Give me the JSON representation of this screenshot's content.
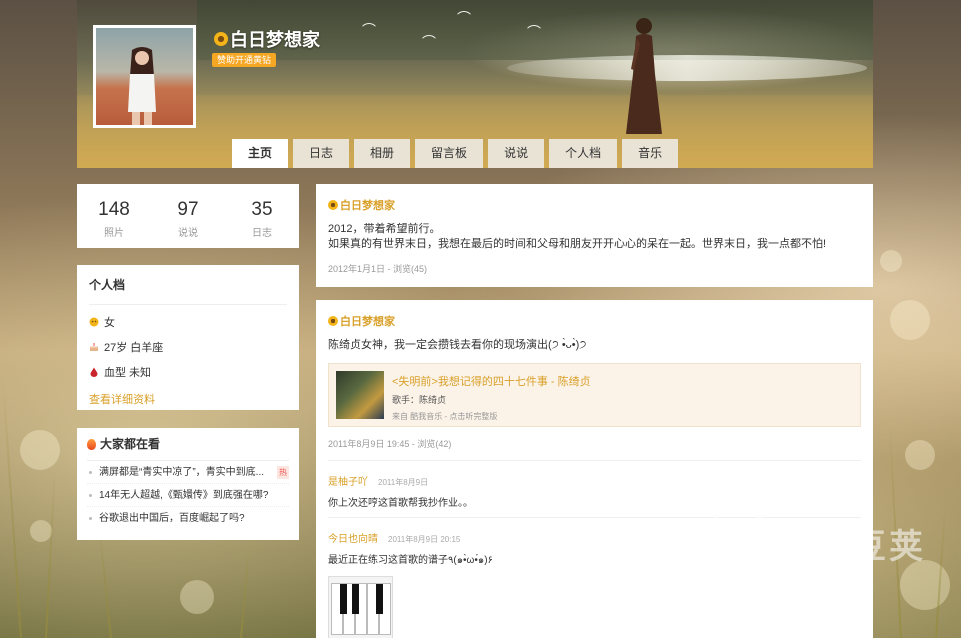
{
  "owner": {
    "name": "白日梦想家",
    "vip_label": "赞助开通黄钻",
    "accent_color": "#d9a02a"
  },
  "nav": {
    "tabs": [
      {
        "label": "主页",
        "active": true
      },
      {
        "label": "日志",
        "active": false
      },
      {
        "label": "相册",
        "active": false
      },
      {
        "label": "留言板",
        "active": false
      },
      {
        "label": "说说",
        "active": false
      },
      {
        "label": "个人档",
        "active": false
      },
      {
        "label": "音乐",
        "active": false
      }
    ]
  },
  "stats": [
    {
      "value": "148",
      "label": "照片"
    },
    {
      "value": "97",
      "label": "说说"
    },
    {
      "value": "35",
      "label": "日志"
    }
  ],
  "profile": {
    "title": "个人档",
    "gender": "女",
    "age_sign": "27岁 白羊座",
    "blood": "血型 未知",
    "more_link": "查看详细资料"
  },
  "trending": {
    "title": "大家都在看",
    "items": [
      {
        "text": "满屏都是“青实中凉了”，青实中到底...",
        "badge": "热"
      },
      {
        "text": "14年无人超越,《甄嬛传》到底强在哪?",
        "badge": ""
      },
      {
        "text": "谷歌退出中国后，百度崛起了吗?",
        "badge": ""
      }
    ]
  },
  "posts": [
    {
      "author": "白日梦想家",
      "line1": "2012，带着希望前行。",
      "line2": "如果真的有世界末日，我想在最后的时间和父母和朋友开开心心的呆在一起。世界末日，我一点都不怕!",
      "meta": "2012年1月1日 - ",
      "views": "浏览(45)"
    },
    {
      "author": "白日梦想家",
      "text": "陈绮贞女神，我一定会攒钱去看你的现场演出(੭ •̀ᴗ•̀)੭",
      "music": {
        "title": "<失明前>我想记得的四十七件事 - 陈绮贞",
        "artist": "歌手：陈绮贞",
        "source": "来自 酷我音乐 - 点击听完整版"
      },
      "meta": "2011年8月9日 19:45 - ",
      "views": "浏览(42)",
      "comments": [
        {
          "author": "是柚子吖",
          "time": "2011年8月9日",
          "text": "你上次还哼这首歌帮我抄作业。。"
        },
        {
          "author": "今日也向晴",
          "time": "2011年8月9日 20:15",
          "text": "最近正在练习这首歌的谱子٩(๑•̀ω•́๑)۶"
        }
      ]
    }
  ],
  "watermark": "豌豆荚",
  "icons": {
    "flower": "sunflower-icon",
    "gender": "gender-icon",
    "cake": "cake-icon",
    "blood": "blood-drop-icon",
    "fire": "fire-icon"
  }
}
